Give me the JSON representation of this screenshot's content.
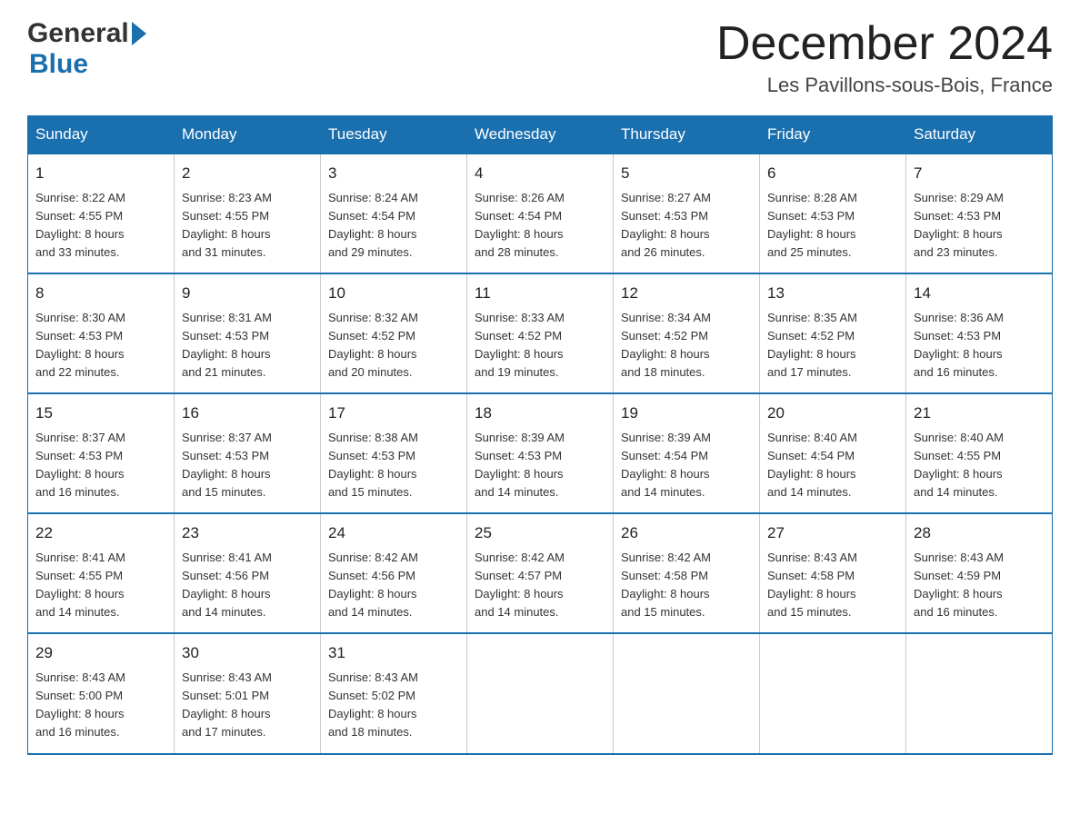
{
  "header": {
    "logo_general": "General",
    "logo_blue": "Blue",
    "month_title": "December 2024",
    "location": "Les Pavillons-sous-Bois, France"
  },
  "days_of_week": [
    "Sunday",
    "Monday",
    "Tuesday",
    "Wednesday",
    "Thursday",
    "Friday",
    "Saturday"
  ],
  "weeks": [
    [
      {
        "day": "1",
        "sunrise": "8:22 AM",
        "sunset": "4:55 PM",
        "daylight": "8 hours and 33 minutes."
      },
      {
        "day": "2",
        "sunrise": "8:23 AM",
        "sunset": "4:55 PM",
        "daylight": "8 hours and 31 minutes."
      },
      {
        "day": "3",
        "sunrise": "8:24 AM",
        "sunset": "4:54 PM",
        "daylight": "8 hours and 29 minutes."
      },
      {
        "day": "4",
        "sunrise": "8:26 AM",
        "sunset": "4:54 PM",
        "daylight": "8 hours and 28 minutes."
      },
      {
        "day": "5",
        "sunrise": "8:27 AM",
        "sunset": "4:53 PM",
        "daylight": "8 hours and 26 minutes."
      },
      {
        "day": "6",
        "sunrise": "8:28 AM",
        "sunset": "4:53 PM",
        "daylight": "8 hours and 25 minutes."
      },
      {
        "day": "7",
        "sunrise": "8:29 AM",
        "sunset": "4:53 PM",
        "daylight": "8 hours and 23 minutes."
      }
    ],
    [
      {
        "day": "8",
        "sunrise": "8:30 AM",
        "sunset": "4:53 PM",
        "daylight": "8 hours and 22 minutes."
      },
      {
        "day": "9",
        "sunrise": "8:31 AM",
        "sunset": "4:53 PM",
        "daylight": "8 hours and 21 minutes."
      },
      {
        "day": "10",
        "sunrise": "8:32 AM",
        "sunset": "4:52 PM",
        "daylight": "8 hours and 20 minutes."
      },
      {
        "day": "11",
        "sunrise": "8:33 AM",
        "sunset": "4:52 PM",
        "daylight": "8 hours and 19 minutes."
      },
      {
        "day": "12",
        "sunrise": "8:34 AM",
        "sunset": "4:52 PM",
        "daylight": "8 hours and 18 minutes."
      },
      {
        "day": "13",
        "sunrise": "8:35 AM",
        "sunset": "4:52 PM",
        "daylight": "8 hours and 17 minutes."
      },
      {
        "day": "14",
        "sunrise": "8:36 AM",
        "sunset": "4:53 PM",
        "daylight": "8 hours and 16 minutes."
      }
    ],
    [
      {
        "day": "15",
        "sunrise": "8:37 AM",
        "sunset": "4:53 PM",
        "daylight": "8 hours and 16 minutes."
      },
      {
        "day": "16",
        "sunrise": "8:37 AM",
        "sunset": "4:53 PM",
        "daylight": "8 hours and 15 minutes."
      },
      {
        "day": "17",
        "sunrise": "8:38 AM",
        "sunset": "4:53 PM",
        "daylight": "8 hours and 15 minutes."
      },
      {
        "day": "18",
        "sunrise": "8:39 AM",
        "sunset": "4:53 PM",
        "daylight": "8 hours and 14 minutes."
      },
      {
        "day": "19",
        "sunrise": "8:39 AM",
        "sunset": "4:54 PM",
        "daylight": "8 hours and 14 minutes."
      },
      {
        "day": "20",
        "sunrise": "8:40 AM",
        "sunset": "4:54 PM",
        "daylight": "8 hours and 14 minutes."
      },
      {
        "day": "21",
        "sunrise": "8:40 AM",
        "sunset": "4:55 PM",
        "daylight": "8 hours and 14 minutes."
      }
    ],
    [
      {
        "day": "22",
        "sunrise": "8:41 AM",
        "sunset": "4:55 PM",
        "daylight": "8 hours and 14 minutes."
      },
      {
        "day": "23",
        "sunrise": "8:41 AM",
        "sunset": "4:56 PM",
        "daylight": "8 hours and 14 minutes."
      },
      {
        "day": "24",
        "sunrise": "8:42 AM",
        "sunset": "4:56 PM",
        "daylight": "8 hours and 14 minutes."
      },
      {
        "day": "25",
        "sunrise": "8:42 AM",
        "sunset": "4:57 PM",
        "daylight": "8 hours and 14 minutes."
      },
      {
        "day": "26",
        "sunrise": "8:42 AM",
        "sunset": "4:58 PM",
        "daylight": "8 hours and 15 minutes."
      },
      {
        "day": "27",
        "sunrise": "8:43 AM",
        "sunset": "4:58 PM",
        "daylight": "8 hours and 15 minutes."
      },
      {
        "day": "28",
        "sunrise": "8:43 AM",
        "sunset": "4:59 PM",
        "daylight": "8 hours and 16 minutes."
      }
    ],
    [
      {
        "day": "29",
        "sunrise": "8:43 AM",
        "sunset": "5:00 PM",
        "daylight": "8 hours and 16 minutes."
      },
      {
        "day": "30",
        "sunrise": "8:43 AM",
        "sunset": "5:01 PM",
        "daylight": "8 hours and 17 minutes."
      },
      {
        "day": "31",
        "sunrise": "8:43 AM",
        "sunset": "5:02 PM",
        "daylight": "8 hours and 18 minutes."
      },
      null,
      null,
      null,
      null
    ]
  ],
  "labels": {
    "sunrise": "Sunrise:",
    "sunset": "Sunset:",
    "daylight": "Daylight:"
  }
}
